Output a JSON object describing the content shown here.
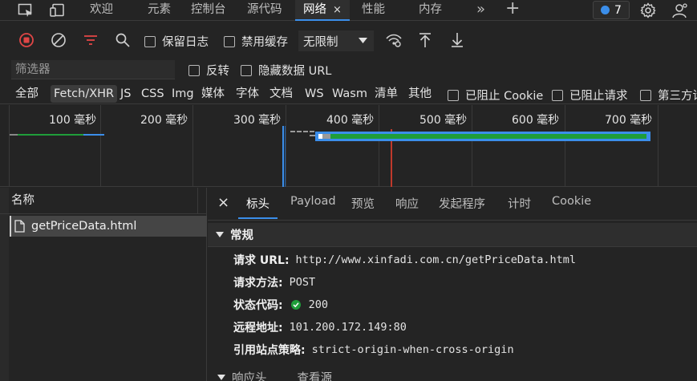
{
  "tabs": {
    "welcome": "欢迎",
    "elements": "元素",
    "console": "控制台",
    "sources": "源代码",
    "network": "网络",
    "close": "×",
    "performance": "性能",
    "memory": "内存",
    "more": "»",
    "add": "+"
  },
  "issues_badge": {
    "count": "7",
    "color": "#3b8eea"
  },
  "toolbar": {
    "preserve_log": "保留日志",
    "disable_cache": "禁用缓存",
    "throttle": "无限制"
  },
  "filter": {
    "placeholder": "筛选器",
    "invert": "反转",
    "hide_data_url": "隐藏数据 URL"
  },
  "types": [
    "全部",
    "Fetch/XHR",
    "JS",
    "CSS",
    "Img",
    "媒体",
    "字体",
    "文档",
    "WS",
    "Wasm",
    "清单",
    "其他"
  ],
  "type_checks": {
    "blocked_cookies": "已阻止 Cookie",
    "blocked_requests": "已阻止请求",
    "third_party": "第三方请"
  },
  "timeline": {
    "ticks": [
      "100 毫秒",
      "200 毫秒",
      "300 毫秒",
      "400 毫秒",
      "500 毫秒",
      "600 毫秒",
      "700 毫秒"
    ]
  },
  "list": {
    "header": "名称",
    "rows": [
      "getPriceData.html"
    ]
  },
  "detail": {
    "close": "×",
    "tabs": [
      "标头",
      "Payload",
      "预览",
      "响应",
      "发起程序",
      "计时",
      "Cookie"
    ],
    "general_title": "常规",
    "request_url_label": "请求 URL:",
    "request_url": "http://www.xinfadi.com.cn/getPriceData.html",
    "method_label": "请求方法:",
    "method": "POST",
    "status_label": "状态代码:",
    "status": "200",
    "remote_label": "远程地址:",
    "remote": "101.200.172.149:80",
    "referrer_label": "引用站点策略:",
    "referrer": "strict-origin-when-cross-origin",
    "response_headers": "响应头",
    "view_source": "查看源"
  },
  "colors": {
    "accent": "#3b8eea",
    "ok": "#1f9d3a",
    "record": "#e04646"
  }
}
